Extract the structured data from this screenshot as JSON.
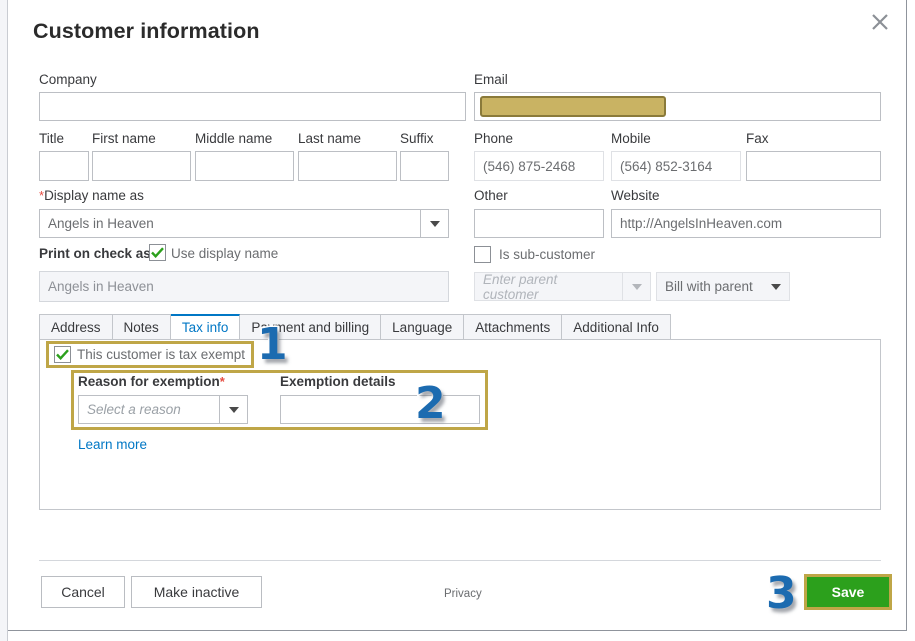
{
  "dialog": {
    "title": "Customer information",
    "close_icon": "close-icon"
  },
  "form": {
    "company_label": "Company",
    "company_value": "",
    "email_label": "Email",
    "email_value": "",
    "email_redacted": true,
    "name_fields": [
      {
        "label": "Title",
        "value": ""
      },
      {
        "label": "First name",
        "value": ""
      },
      {
        "label": "Middle name",
        "value": ""
      },
      {
        "label": "Last name",
        "value": ""
      },
      {
        "label": "Suffix",
        "value": ""
      }
    ],
    "phone_label": "Phone",
    "phone_value": "(546) 875-2468",
    "mobile_label": "Mobile",
    "mobile_value": "(564) 852-3164",
    "fax_label": "Fax",
    "fax_value": "",
    "display_name_label": "Display name as",
    "display_name_required": "*",
    "display_name_value": "Angels in Heaven",
    "other_label": "Other",
    "other_value": "",
    "website_label": "Website",
    "website_value": "http://AngelsInHeaven.com",
    "print_on_check_label": "Print on check as",
    "use_display_name_label": "Use display name",
    "use_display_name_checked": true,
    "print_on_check_value": "Angels in Heaven",
    "is_sub_customer_label": "Is sub-customer",
    "is_sub_customer_checked": false,
    "parent_customer_placeholder": "Enter parent customer",
    "bill_with_parent_label": "Bill with parent"
  },
  "tabs": [
    {
      "label": "Address",
      "active": false
    },
    {
      "label": "Notes",
      "active": false
    },
    {
      "label": "Tax info",
      "active": true
    },
    {
      "label": "Payment and billing",
      "active": false
    },
    {
      "label": "Language",
      "active": false
    },
    {
      "label": "Attachments",
      "active": false
    },
    {
      "label": "Additional Info",
      "active": false
    }
  ],
  "tax_info": {
    "tax_exempt_label": "This customer is tax exempt",
    "tax_exempt_checked": true,
    "reason_label": "Reason for exemption",
    "reason_required": "*",
    "reason_placeholder": "Select a reason",
    "exemption_details_label": "Exemption details",
    "exemption_details_value": "",
    "learn_more_label": "Learn more"
  },
  "footer": {
    "cancel_label": "Cancel",
    "make_inactive_label": "Make inactive",
    "privacy_label": "Privacy",
    "save_label": "Save"
  },
  "annotations": {
    "step1": "1",
    "step2": "2",
    "step3": "3"
  },
  "colors": {
    "accent_blue": "#0077c5",
    "save_green": "#2ca01c",
    "highlight_gold": "#bfa647",
    "redaction": "#c9b363",
    "required_red": "#e54d42",
    "badge_blue": "#1c6bb0"
  }
}
